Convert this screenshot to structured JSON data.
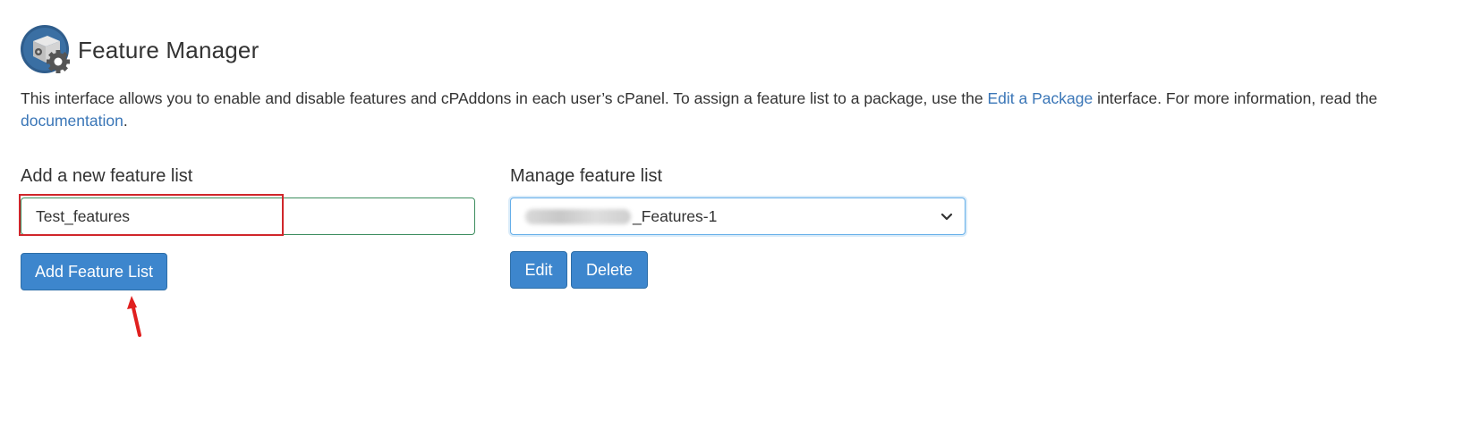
{
  "header": {
    "title": "Feature Manager",
    "logo_icon": "feature-manager-gear-box-icon"
  },
  "description": {
    "text_before": "This interface allows you to enable and disable features and cPAddons in each user’s cPanel. To assign a feature list to a package, use the ",
    "edit_package_link": "Edit a Package",
    "text_middle": " interface. For more information, read the ",
    "documentation_link": "documentation",
    "text_after": "."
  },
  "add_section": {
    "label": "Add a new feature list",
    "input_value": "Test_features",
    "button_label": "Add Feature List"
  },
  "manage_section": {
    "label": "Manage feature list",
    "selected_value_visible": "_Features-1",
    "edit_label": "Edit",
    "delete_label": "Delete"
  },
  "colors": {
    "accent": "#3d86cd",
    "link": "#3a76b7",
    "highlight": "#d0262b",
    "input_border": "#3c8d5e"
  }
}
